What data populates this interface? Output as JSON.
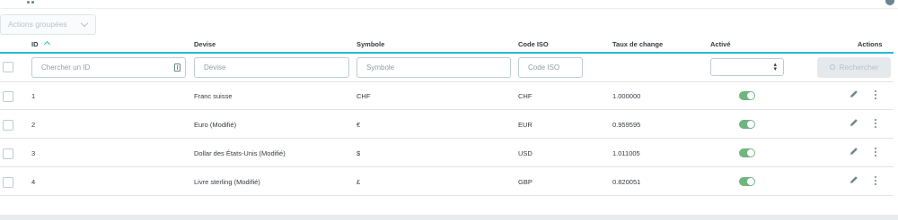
{
  "toolbar": {
    "bulk_actions_label": "Actions groupées"
  },
  "columns": {
    "id": "ID",
    "currency": "Devise",
    "symbol": "Symbole",
    "iso": "Code ISO",
    "rate": "Taux de change",
    "enabled": "Activé",
    "actions": "Actions"
  },
  "filters": {
    "id_placeholder": "Chercher un ID",
    "currency_placeholder": "Devise",
    "symbol_placeholder": "Symbole",
    "iso_placeholder": "Code ISO",
    "search_label": "Rechercher"
  },
  "rows": [
    {
      "id": "1",
      "currency": "Franc suisse",
      "symbol": "CHF",
      "iso": "CHF",
      "rate": "1.000000",
      "enabled": true
    },
    {
      "id": "2",
      "currency": "Euro (Modifié)",
      "symbol": "€",
      "iso": "EUR",
      "rate": "0.959595",
      "enabled": true
    },
    {
      "id": "3",
      "currency": "Dollar des États-Unis (Modifié)",
      "symbol": "$",
      "iso": "USD",
      "rate": "1.011005",
      "enabled": true
    },
    {
      "id": "4",
      "currency": "Livre sterling (Modifié)",
      "symbol": "£",
      "iso": "GBP",
      "rate": "0.820051",
      "enabled": true
    }
  ],
  "colors": {
    "accent": "#25b9d7",
    "toggle_on": "#70b580",
    "border": "#bbcdd2"
  },
  "icons": [
    "more-icon",
    "gear-icon",
    "chevron-down-icon",
    "sort-up-icon",
    "id-spinner-icon",
    "select-arrows-icon",
    "search-icon",
    "pencil-icon",
    "kebab-icon"
  ]
}
